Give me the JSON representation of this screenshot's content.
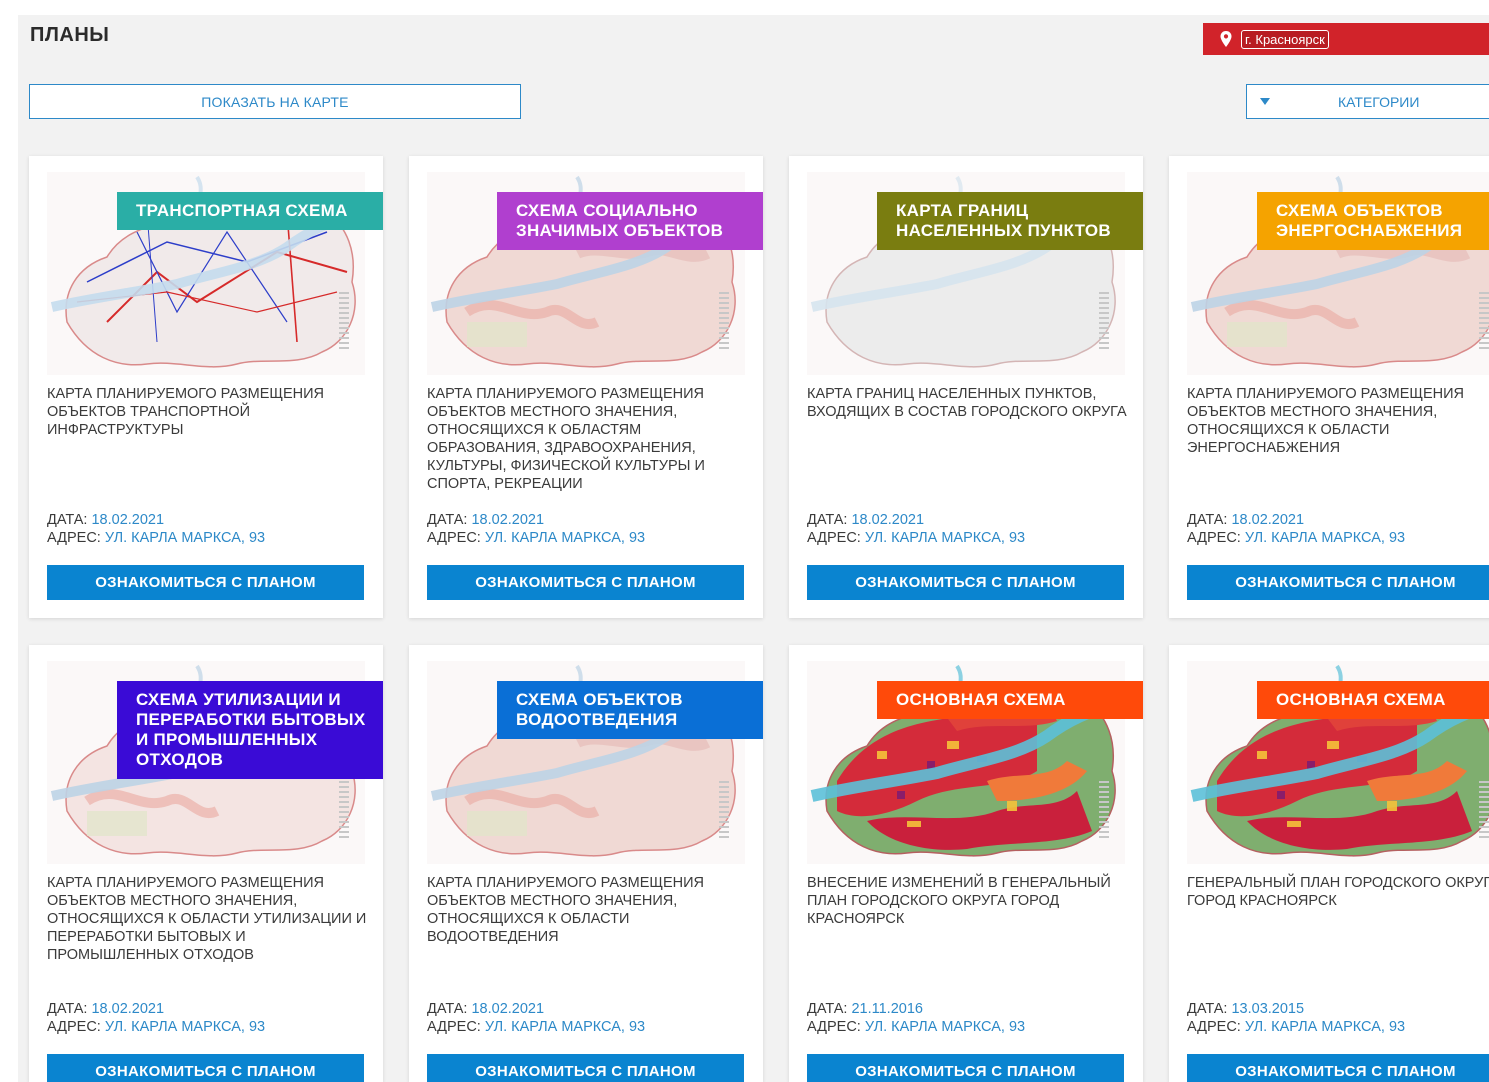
{
  "page": {
    "title": "ПЛАНЫ"
  },
  "header": {
    "city": "г. Красноярск",
    "pin_icon": "location-pin-icon",
    "accent": "#d1232a"
  },
  "controls": {
    "show_on_map": "ПОКАЗАТЬ НА КАРТЕ",
    "categories": "КАТЕГОРИИ",
    "categories_icon": "caret-down-icon"
  },
  "labels": {
    "date": "ДАТА:",
    "address": "АДРЕС:"
  },
  "cards": [
    {
      "category": "ТРАНСПОРТНАЯ СХЕМА",
      "color": "#2aaea6",
      "style": "transport",
      "description": "КАРТА ПЛАНИРУЕМОГО РАЗМЕЩЕНИЯ ОБЪЕКТОВ ТРАНСПОРТНОЙ ИНФРАСТРУКТУРЫ",
      "date": "18.02.2021",
      "address": "УЛ. КАРЛА МАРКСА, 93",
      "button": "ОЗНАКОМИТЬСЯ С ПЛАНОМ"
    },
    {
      "category": "СХЕМА СОЦИАЛЬНО ЗНАЧИМЫХ ОБЪЕКТОВ",
      "color": "#b03fcf",
      "style": "faded",
      "description": "КАРТА ПЛАНИРУЕМОГО РАЗМЕЩЕНИЯ ОБЪЕКТОВ МЕСТНОГО ЗНАЧЕНИЯ, ОТНОСЯЩИХСЯ К ОБЛАСТЯМ ОБРАЗОВАНИЯ, ЗДРАВООХРАНЕНИЯ, КУЛЬТУРЫ, ФИЗИЧЕСКОЙ КУЛЬТУРЫ И СПОРТА, РЕКРЕАЦИИ",
      "date": "18.02.2021",
      "address": "УЛ. КАРЛА МАРКСА, 93",
      "button": "ОЗНАКОМИТЬСЯ С ПЛАНОМ"
    },
    {
      "category": "КАРТА ГРАНИЦ НАСЕЛЕННЫХ ПУНКТОВ",
      "color": "#7a7d10",
      "style": "gray",
      "description": "КАРТА ГРАНИЦ НАСЕЛЕННЫХ ПУНКТОВ, ВХОДЯЩИХ В СОСТАВ ГОРОДСКОГО ОКРУГА",
      "date": "18.02.2021",
      "address": "УЛ. КАРЛА МАРКСА, 93",
      "button": "ОЗНАКОМИТЬСЯ С ПЛАНОМ"
    },
    {
      "category": "СХЕМА ОБЪЕКТОВ ЭНЕРГОСНАБЖЕНИЯ",
      "color": "#f5a300",
      "style": "faded",
      "description": "КАРТА ПЛАНИРУЕМОГО РАЗМЕЩЕНИЯ ОБЪЕКТОВ МЕСТНОГО ЗНАЧЕНИЯ, ОТНОСЯЩИХСЯ К ОБЛАСТИ ЭНЕРГОСНАБЖЕНИЯ",
      "date": "18.02.2021",
      "address": "УЛ. КАРЛА МАРКСА, 93",
      "button": "ОЗНАКОМИТЬСЯ С ПЛАНОМ"
    },
    {
      "category": "СХЕМА УТИЛИЗАЦИИ И ПЕРЕРАБОТКИ БЫТОВЫХ И ПРОМЫШЛЕННЫХ ОТХОДОВ",
      "color": "#3a0bd6",
      "style": "faded-light",
      "description": "КАРТА ПЛАНИРУЕМОГО РАЗМЕЩЕНИЯ ОБЪЕКТОВ МЕСТНОГО ЗНАЧЕНИЯ, ОТНОСЯЩИХСЯ К ОБЛАСТИ УТИЛИЗАЦИИ И ПЕРЕРАБОТКИ БЫТОВЫХ И ПРОМЫШЛЕННЫХ ОТХОДОВ",
      "date": "18.02.2021",
      "address": "УЛ. КАРЛА МАРКСА, 93",
      "button": "ОЗНАКОМИТЬСЯ С ПЛАНОМ"
    },
    {
      "category": "СХЕМА ОБЪЕКТОВ ВОДООТВЕДЕНИЯ",
      "color": "#0a6fd6",
      "style": "faded",
      "description": "КАРТА ПЛАНИРУЕМОГО РАЗМЕЩЕНИЯ ОБЪЕКТОВ МЕСТНОГО ЗНАЧЕНИЯ, ОТНОСЯЩИХСЯ К ОБЛАСТИ ВОДООТВЕДЕНИЯ",
      "date": "18.02.2021",
      "address": "УЛ. КАРЛА МАРКСА, 93",
      "button": "ОЗНАКОМИТЬСЯ С ПЛАНОМ"
    },
    {
      "category": "ОСНОВНАЯ СХЕМА",
      "color": "#ff4a0a",
      "style": "vivid",
      "description": "ВНЕСЕНИЕ ИЗМЕНЕНИЙ В ГЕНЕРАЛЬНЫЙ ПЛАН ГОРОДСКОГО ОКРУГА ГОРОД КРАСНОЯРСК",
      "date": "21.11.2016",
      "address": "УЛ. КАРЛА МАРКСА, 93",
      "button": "ОЗНАКОМИТЬСЯ С ПЛАНОМ"
    },
    {
      "category": "ОСНОВНАЯ СХЕМА",
      "color": "#ff4a0a",
      "style": "vivid",
      "description": "ГЕНЕРАЛЬНЫЙ ПЛАН ГОРОДСКОГО ОКРУГА ГОРОД КРАСНОЯРСК",
      "date": "13.03.2015",
      "address": "УЛ. КАРЛА МАРКСА, 93",
      "button": "ОЗНАКОМИТЬСЯ С ПЛАНОМ"
    }
  ]
}
